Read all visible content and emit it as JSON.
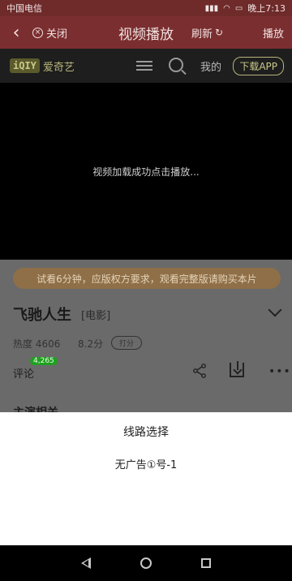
{
  "status_bar": {
    "carrier": "中国电信",
    "time": "晚上7:13"
  },
  "title_bar": {
    "back_glyph": "‹",
    "close_label": "关闭",
    "title": "视频播放",
    "refresh_label": "刷新",
    "play_label": "播放"
  },
  "site_header": {
    "logo_badge": "iQIY",
    "logo_text": "爱奇艺",
    "mine_label": "我的",
    "download_app_label": "下载APP"
  },
  "video": {
    "message": "视频加载成功点击播放..."
  },
  "content": {
    "trial_banner": "试看6分钟，应版权方要求，观看完整版请购买本片",
    "movie_title": "飞驰人生",
    "movie_type": "[电影]",
    "heat": "热度 4606",
    "score": "8.2分",
    "rate_label": "打分",
    "comment_label": "评论",
    "comment_count": "4,265",
    "section_title": "主演相关"
  },
  "sheet": {
    "title": "线路选择",
    "option": "无广告①号-1"
  },
  "colors": {
    "title_bar_bg": "#7b2e2f",
    "video_bg": "#000000",
    "trial_banner_bg": "#8e6f48",
    "comment_badge_bg": "#20a020"
  }
}
